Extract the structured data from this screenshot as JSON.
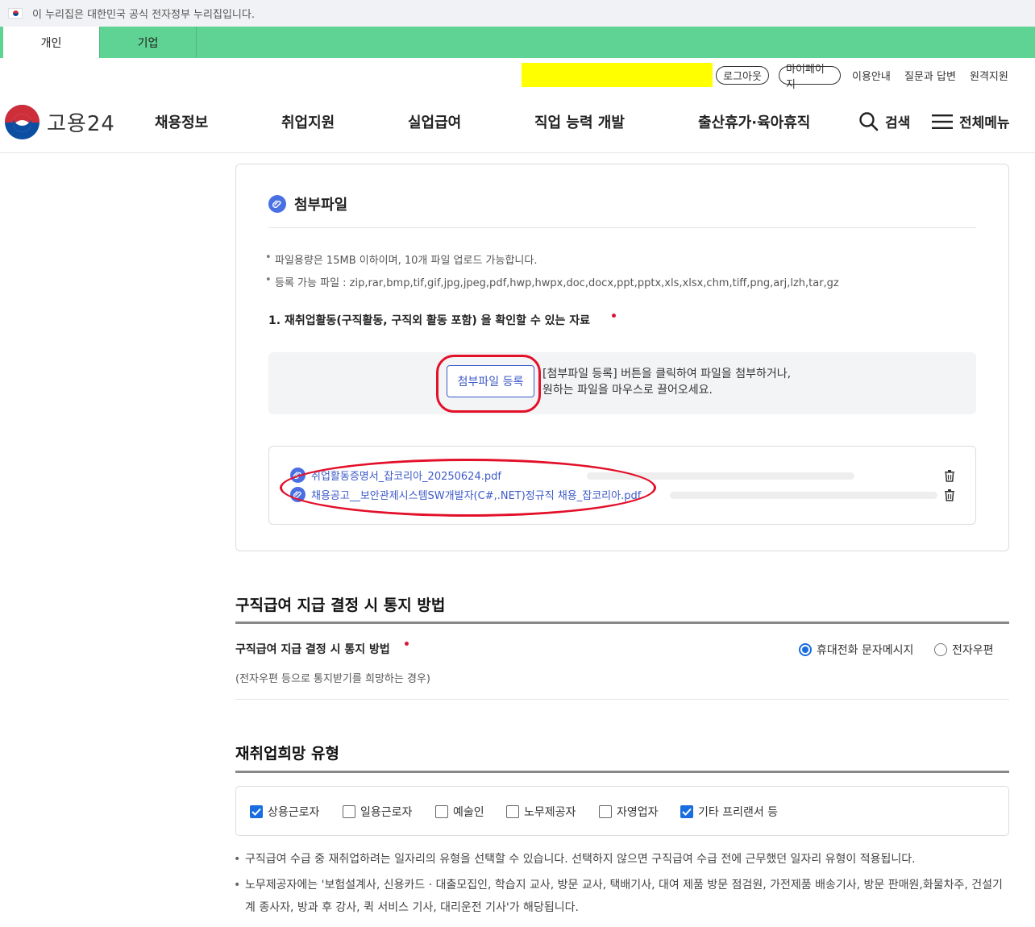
{
  "gov_banner": {
    "text": "이 누리집은 대한민국 공식 전자정부 누리집입니다."
  },
  "user_tabs": [
    {
      "label": "개인"
    },
    {
      "label": "기업"
    }
  ],
  "util_links": {
    "logout": "로그아웃",
    "mypage": "마이페이지",
    "guide": "이용안내",
    "qna": "질문과 답변",
    "remote": "원격지원"
  },
  "logo": {
    "text": "고용24"
  },
  "gnb": [
    {
      "label": "채용정보"
    },
    {
      "label": "취업지원"
    },
    {
      "label": "실업급여"
    },
    {
      "label": "직업 능력 개발"
    },
    {
      "label": "출산휴가·육아휴직"
    }
  ],
  "header_actions": {
    "search": "검색",
    "all_menu": "전체메뉴"
  },
  "attach": {
    "title": "첨부파일",
    "notes": [
      "파일용량은 15MB 이하이며, 10개 파일 업로드 가능합니다.",
      "등록 가능 파일 : zip,rar,bmp,tif,gif,jpg,jpeg,pdf,hwp,hwpx,doc,docx,ppt,pptx,xls,xlsx,chm,tiff,png,arj,lzh,tar,gz"
    ],
    "requirement": "1. 재취업활동(구직활동, 구직외 활동 포함) 을 확인할 수 있는 자료",
    "button": "첨부파일 등록",
    "drop_text_1": "[첨부파일 등록] 버튼을 클릭하여 파일을 첨부하거나,",
    "drop_text_2": "원하는 파일을 마우스로 끌어오세요.",
    "files": [
      {
        "name": "취업활동증명서_잡코리아_20250624.pdf"
      },
      {
        "name": "채용공고__보안관제시스템SW개발자(C#,.NET)정규직 채용_잡코리아.pdf"
      }
    ]
  },
  "notify": {
    "section_title": "구직급여 지급 결정 시 통지 방법",
    "label": "구직급여 지급 결정 시 통지 방법",
    "sub": "(전자우편 등으로 통지받기를 희망하는 경우)",
    "options": [
      {
        "label": "휴대전화 문자메시지",
        "selected": true
      },
      {
        "label": "전자우편",
        "selected": false
      }
    ]
  },
  "reemploy": {
    "section_title": "재취업희망 유형",
    "options": [
      {
        "label": "상용근로자",
        "checked": true
      },
      {
        "label": "일용근로자",
        "checked": false
      },
      {
        "label": "예술인",
        "checked": false
      },
      {
        "label": "노무제공자",
        "checked": false
      },
      {
        "label": "자영업자",
        "checked": false
      },
      {
        "label": "기타 프리랜서 등",
        "checked": true
      }
    ],
    "notes": [
      "구직급여 수급 중 재취업하려는 일자리의 유형을 선택할 수 있습니다. 선택하지 않으면 구직급여 수급 전에 근무했던 일자리 유형이 적용됩니다.",
      "노무제공자에는 '보험설계사, 신용카드 · 대출모집인, 학습지 교사, 방문 교사, 택배기사, 대여 제품 방문 점검원, 가전제품 배송기사, 방문 판매원,화물차주, 건설기계 종사자, 방과 후 강사, 퀵 서비스 기사, 대리운전 기사'가 해당됩니다."
    ]
  },
  "colors": {
    "tab_green": "#5fd393",
    "accent_blue": "#3d5ac8",
    "required_red": "#d9143a",
    "annotation_red": "#e3102a",
    "highlight_yellow": "#ffff00"
  }
}
